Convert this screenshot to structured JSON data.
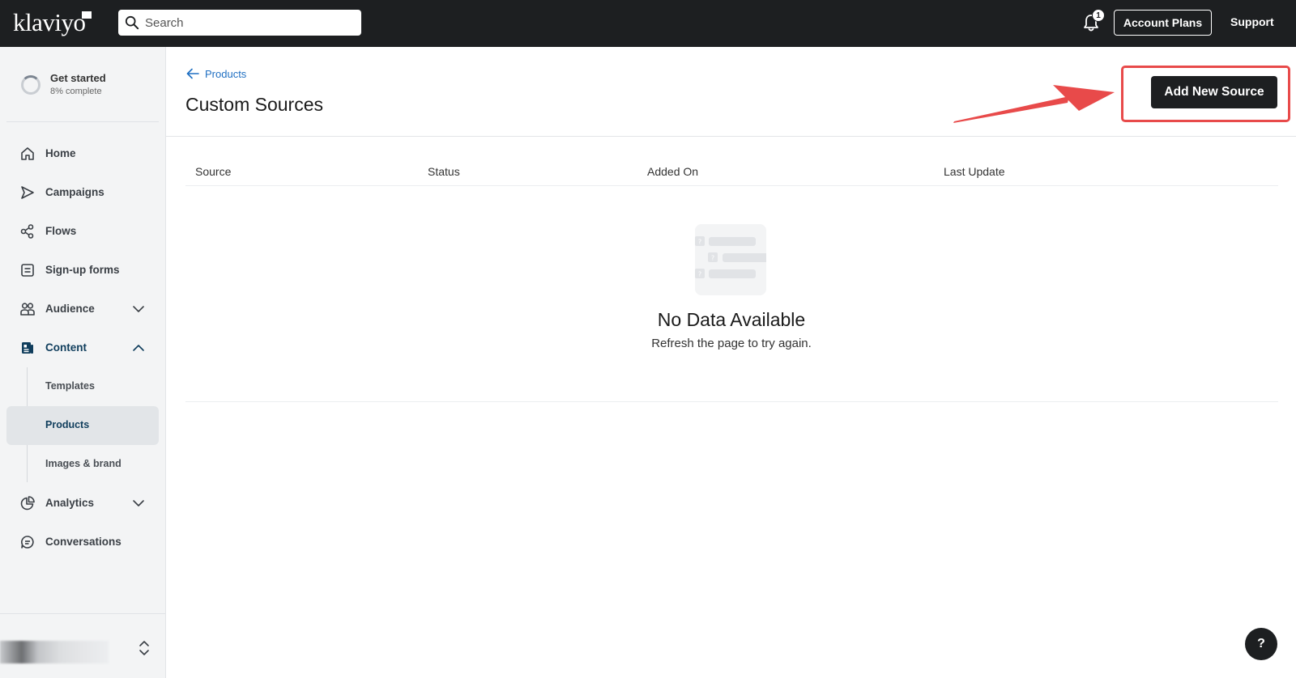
{
  "topbar": {
    "logo_text": "klaviyo",
    "search_placeholder": "Search",
    "notification_count": "1",
    "account_plans_label": "Account Plans",
    "support_label": "Support"
  },
  "sidebar": {
    "get_started": {
      "title": "Get started",
      "progress_text": "8% complete",
      "progress_fraction": 0.08
    },
    "items": [
      {
        "label": "Home",
        "icon": "home-icon"
      },
      {
        "label": "Campaigns",
        "icon": "send-icon"
      },
      {
        "label": "Flows",
        "icon": "flows-icon"
      },
      {
        "label": "Sign-up forms",
        "icon": "form-icon"
      },
      {
        "label": "Audience",
        "icon": "users-icon",
        "expandable": true,
        "expanded": false
      },
      {
        "label": "Content",
        "icon": "content-icon",
        "expandable": true,
        "expanded": true
      },
      {
        "label": "Analytics",
        "icon": "pie-chart-icon",
        "expandable": true,
        "expanded": false
      },
      {
        "label": "Conversations",
        "icon": "chat-icon"
      }
    ],
    "content_subitems": [
      {
        "label": "Templates"
      },
      {
        "label": "Products",
        "selected": true
      },
      {
        "label": "Images & brand"
      }
    ]
  },
  "main": {
    "back_label": "Products",
    "title": "Custom Sources",
    "add_button_label": "Add New Source",
    "table": {
      "columns": [
        "Source",
        "Status",
        "Added On",
        "Last Update"
      ]
    },
    "empty_state": {
      "title": "No Data Available",
      "subtitle": "Refresh the page to try again."
    }
  },
  "help_button_label": "?",
  "colors": {
    "topbar": "#1d1f21",
    "link": "#1f6fc2",
    "annotation": "#e84a4a",
    "sidebar_bg": "#f3f4f5"
  }
}
